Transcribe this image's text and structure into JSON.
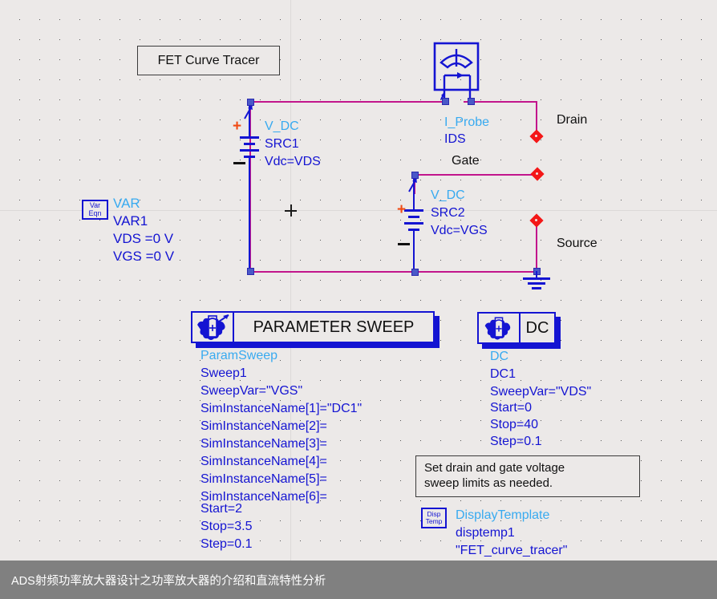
{
  "app": {
    "kind": "ads-schematic-canvas",
    "background_color": "#ece9e8",
    "wire_color": "#c2158c",
    "component_color": "#1414d2",
    "accent_cyan": "#38aaf0",
    "port_color": "#f41717"
  },
  "title_box": {
    "label": "FET Curve Tracer"
  },
  "note_box": {
    "line1": "Set drain and gate voltage",
    "line2": "sweep limits as needed."
  },
  "ports": [
    {
      "name": "drain",
      "label": "Drain"
    },
    {
      "name": "gate",
      "label": "Gate"
    },
    {
      "name": "source",
      "label": "Source"
    }
  ],
  "components": {
    "var_eqn": {
      "icon_line1": "Var",
      "icon_line2": "Eqn",
      "type": "VAR",
      "instance": "VAR1",
      "params": [
        "VDS =0 V",
        "VGS =0 V"
      ]
    },
    "src1": {
      "type": "V_DC",
      "instance": "SRC1",
      "param": "Vdc=VDS",
      "plus": "+",
      "minus": "−"
    },
    "src2": {
      "type": "V_DC",
      "instance": "SRC2",
      "param": "Vdc=VGS",
      "plus": "+",
      "minus": "−"
    },
    "iprobe": {
      "type": "I_Probe",
      "instance": "IDS"
    },
    "param_sweep": {
      "title": "PARAMETER SWEEP",
      "type": "ParamSweep",
      "instance": "Sweep1",
      "params": [
        "SweepVar=\"VGS\"",
        "SimInstanceName[1]=\"DC1\"",
        "SimInstanceName[2]=",
        "SimInstanceName[3]=",
        "SimInstanceName[4]=",
        "SimInstanceName[5]=",
        "SimInstanceName[6]=",
        "Start=2",
        "Stop=3.5",
        "Step=0.1"
      ]
    },
    "dc_sim": {
      "title": "DC",
      "type": "DC",
      "instance": "DC1",
      "params": [
        "SweepVar=\"VDS\"",
        "Start=0",
        "Stop=40",
        "Step=0.1"
      ]
    },
    "disp_template": {
      "icon_line1": "Disp",
      "icon_line2": "Temp",
      "type": "DisplayTemplate",
      "instance": "disptemp1",
      "param": "\"FET_curve_tracer\""
    }
  },
  "banner": {
    "text": "ADS射频功率放大器设计之功率放大器的介绍和直流特性分析"
  }
}
